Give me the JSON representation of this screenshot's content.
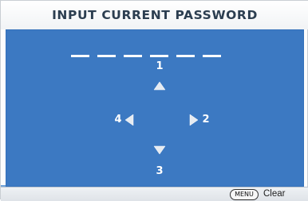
{
  "dialog": {
    "title": "INPUT CURRENT PASSWORD",
    "password_entry": {
      "dash_count": 6
    },
    "directions": {
      "up": {
        "digit": "1",
        "icon": "arrow-up-icon"
      },
      "right": {
        "digit": "2",
        "icon": "arrow-right-icon"
      },
      "down": {
        "digit": "3",
        "icon": "arrow-down-icon"
      },
      "left": {
        "digit": "4",
        "icon": "arrow-left-icon"
      }
    },
    "footer": {
      "key_label": "MENU",
      "action_label": "Clear"
    }
  },
  "colors": {
    "panel_blue": "#3c79c2",
    "title_text": "#2c3e50",
    "mark_white": "#ffffff",
    "arrow_gray": "#e6ebf1"
  }
}
